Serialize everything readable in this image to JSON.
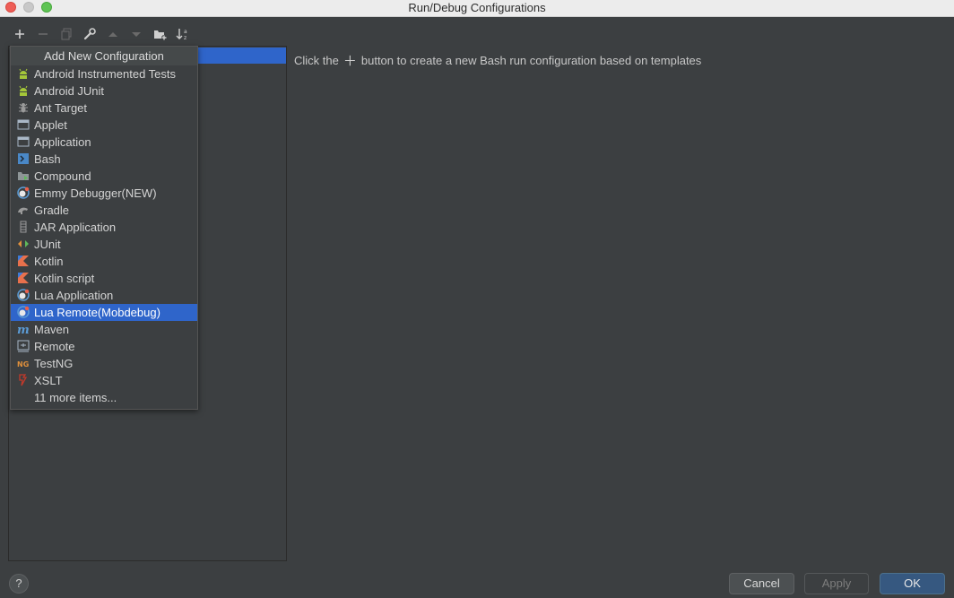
{
  "window": {
    "title": "Run/Debug Configurations"
  },
  "toolbar": {
    "buttons": [
      {
        "name": "add-icon"
      },
      {
        "name": "remove-icon"
      },
      {
        "name": "copy-icon"
      },
      {
        "name": "wrench-icon"
      },
      {
        "name": "move-up-icon"
      },
      {
        "name": "move-down-icon"
      },
      {
        "name": "new-folder-icon"
      },
      {
        "name": "sort-icon"
      }
    ]
  },
  "popup": {
    "header": "Add New Configuration",
    "selected_index": 14,
    "items": [
      {
        "label": "Android Instrumented Tests",
        "icon": "android-icon",
        "color": "#a4c639"
      },
      {
        "label": "Android JUnit",
        "icon": "android-icon",
        "color": "#a4c639"
      },
      {
        "label": "Ant Target",
        "icon": "ant-icon",
        "color": "#9a9a9a"
      },
      {
        "label": "Applet",
        "icon": "applet-icon",
        "color": "#a9b7c6"
      },
      {
        "label": "Application",
        "icon": "application-icon",
        "color": "#a9b7c6"
      },
      {
        "label": "Bash",
        "icon": "bash-icon",
        "color": "#4a88c7"
      },
      {
        "label": "Compound",
        "icon": "compound-icon",
        "color": "#8e9597"
      },
      {
        "label": "Emmy Debugger(NEW)",
        "icon": "emmy-debugger-icon",
        "color": "#e8604c"
      },
      {
        "label": "Gradle",
        "icon": "gradle-icon",
        "color": "#9a9a9a"
      },
      {
        "label": "JAR Application",
        "icon": "jar-icon",
        "color": "#9a9a9a"
      },
      {
        "label": "JUnit",
        "icon": "junit-icon",
        "color": "#e0903c"
      },
      {
        "label": "Kotlin",
        "icon": "kotlin-icon",
        "color": "#e8704c"
      },
      {
        "label": "Kotlin script",
        "icon": "kotlin-script-icon",
        "color": "#e8704c"
      },
      {
        "label": "Lua Application",
        "icon": "lua-icon",
        "color": "#e8604c"
      },
      {
        "label": "Lua Remote(Mobdebug)",
        "icon": "lua-remote-icon",
        "color": "#e8604c"
      },
      {
        "label": "Maven",
        "icon": "maven-icon",
        "color": "#5b9bd5"
      },
      {
        "label": "Remote",
        "icon": "remote-icon",
        "color": "#a9b7c6"
      },
      {
        "label": "TestNG",
        "icon": "testng-icon",
        "color": "#e0903c"
      },
      {
        "label": "XSLT",
        "icon": "xslt-icon",
        "color": "#c0392b"
      },
      {
        "label": "11 more items...",
        "icon": "",
        "color": ""
      }
    ]
  },
  "message": {
    "before": "Click the",
    "after": "button to create a new Bash run configuration based on templates"
  },
  "footer": {
    "help": "?",
    "cancel": "Cancel",
    "apply": "Apply",
    "ok": "OK"
  },
  "colors": {
    "background": "#3c3f41",
    "selection": "#2f65ca",
    "ok_button": "#365880"
  }
}
